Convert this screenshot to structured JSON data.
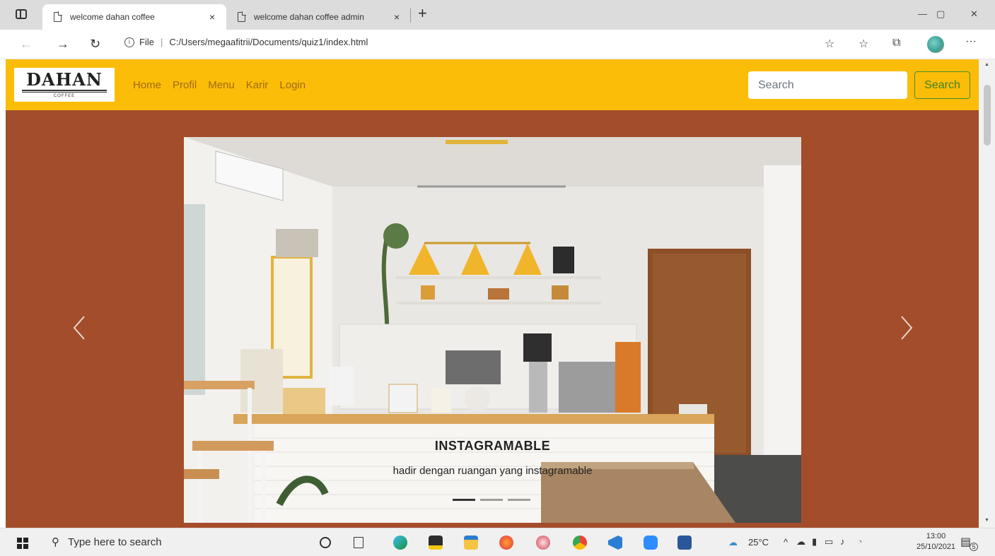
{
  "browser": {
    "tabs": [
      {
        "title": "welcome dahan coffee",
        "close": "×"
      },
      {
        "title": "welcome dahan coffee admin",
        "close": "×"
      }
    ],
    "new_tab": "+",
    "window_controls": {
      "minimize": "—",
      "maximize": "▢",
      "close": "✕"
    },
    "nav": {
      "back": "←",
      "forward": "→",
      "refresh": "↻"
    },
    "address": {
      "protocol_icon": "i",
      "protocol": "File",
      "separator": "|",
      "url": "C:/Users/megaafitrii/Documents/quiz1/index.html"
    },
    "toolbar_icons": [
      "favorite-add-icon",
      "favorites-icon",
      "collections-icon",
      "profile-avatar",
      "more-icon"
    ],
    "more": "···"
  },
  "site": {
    "logo": {
      "word": "DAHAN",
      "sub": "COFFEE"
    },
    "nav_links": [
      "Home",
      "Profil",
      "Menu",
      "Karir",
      "Login"
    ],
    "search": {
      "placeholder": "Search",
      "button": "Search"
    },
    "colors": {
      "navbar": "#fbbd08",
      "page_bg": "#a34d2b",
      "nav_link": "#a16a12",
      "search_button": "#3f7f25"
    }
  },
  "carousel": {
    "slide_title": "INSTAGRAMABLE",
    "slide_text": "hadir dengan ruangan yang instagramable",
    "prev": "‹",
    "next": "›",
    "slide_count": 3,
    "active_slide": 1
  },
  "taskbar": {
    "search_placeholder": "Type here to search",
    "apps": [
      "cortana-icon",
      "task-view-icon",
      "edge-icon",
      "sticky-icon",
      "file-explorer-icon",
      "firefox-icon",
      "snipping-icon",
      "chrome-icon",
      "vscode-icon",
      "zoom-icon",
      "word-icon"
    ],
    "weather": "25°C",
    "tray_chevron": "^",
    "time": "13:00",
    "date": "25/10/2021",
    "notification_count": "5"
  }
}
